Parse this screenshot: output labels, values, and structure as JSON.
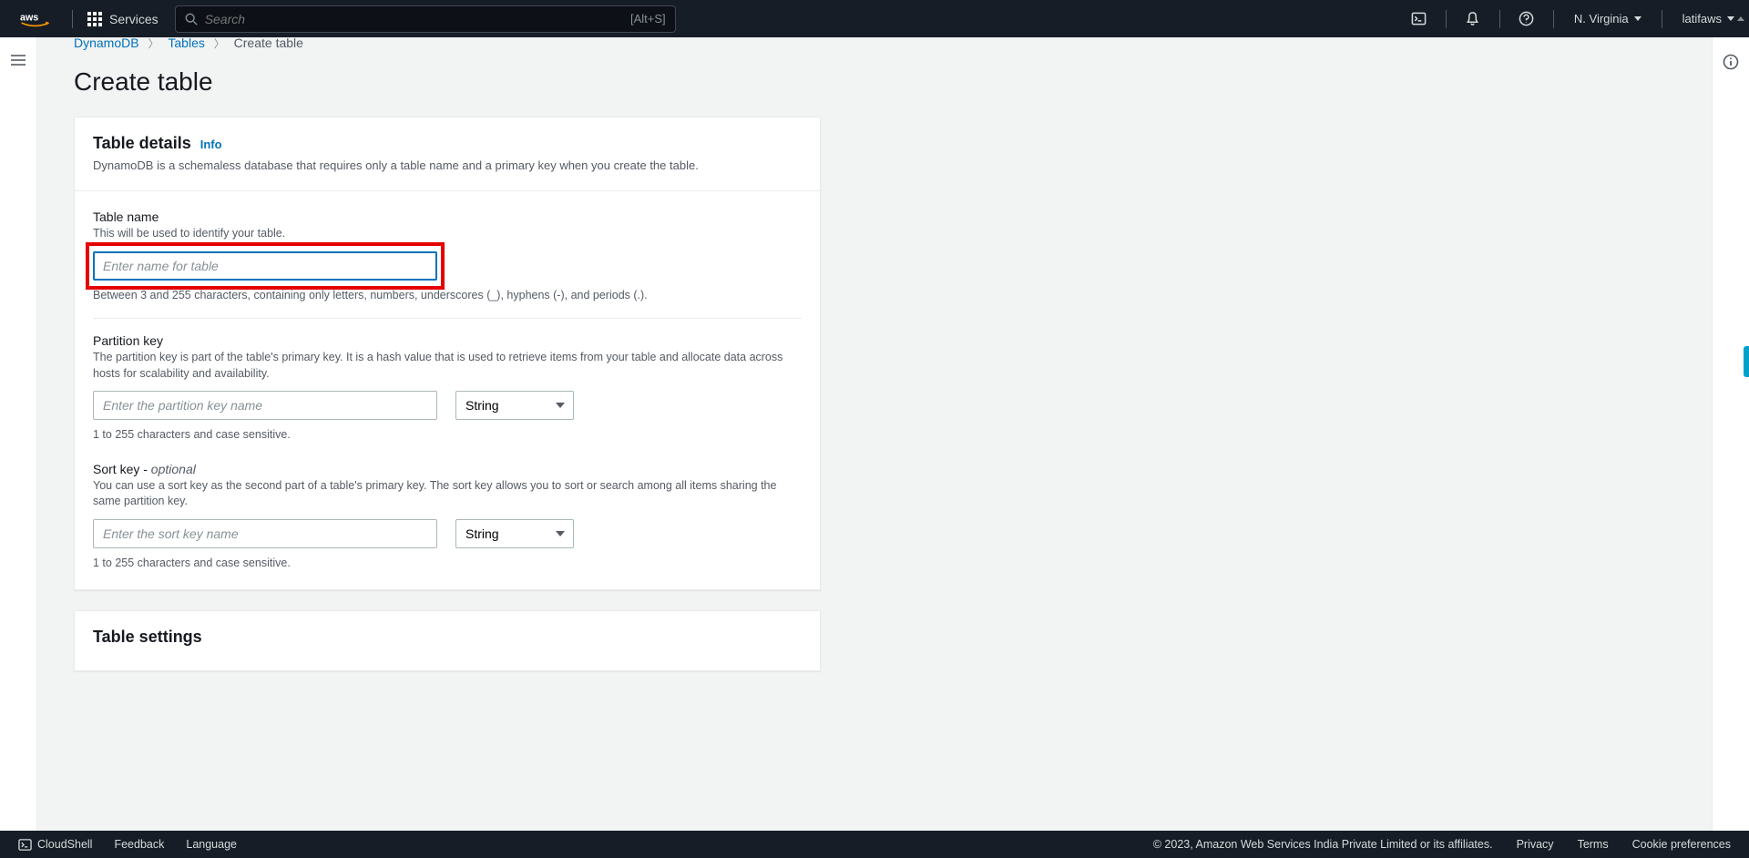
{
  "topnav": {
    "services_label": "Services",
    "search_placeholder": "Search",
    "search_shortcut": "[Alt+S]",
    "region": "N. Virginia",
    "account": "latifaws"
  },
  "breadcrumbs": {
    "service": "DynamoDB",
    "tables": "Tables",
    "current": "Create table"
  },
  "page": {
    "title": "Create table"
  },
  "details_panel": {
    "title": "Table details",
    "info": "Info",
    "desc": "DynamoDB is a schemaless database that requires only a table name and a primary key when you create the table.",
    "table_name": {
      "label": "Table name",
      "hint": "This will be used to identify your table.",
      "placeholder": "Enter name for table",
      "constraint": "Between 3 and 255 characters, containing only letters, numbers, underscores (_), hyphens (-), and periods (.)."
    },
    "partition_key": {
      "label": "Partition key",
      "hint": "The partition key is part of the table's primary key. It is a hash value that is used to retrieve items from your table and allocate data across hosts for scalability and availability.",
      "placeholder": "Enter the partition key name",
      "type_selected": "String",
      "constraint": "1 to 255 characters and case sensitive."
    },
    "sort_key": {
      "label": "Sort key - ",
      "optional": "optional",
      "hint": "You can use a sort key as the second part of a table's primary key. The sort key allows you to sort or search among all items sharing the same partition key.",
      "placeholder": "Enter the sort key name",
      "type_selected": "String",
      "constraint": "1 to 255 characters and case sensitive."
    }
  },
  "settings_panel": {
    "title": "Table settings"
  },
  "footer": {
    "cloudshell": "CloudShell",
    "feedback": "Feedback",
    "language": "Language",
    "copyright": "© 2023, Amazon Web Services India Private Limited or its affiliates.",
    "privacy": "Privacy",
    "terms": "Terms",
    "cookies": "Cookie preferences"
  }
}
